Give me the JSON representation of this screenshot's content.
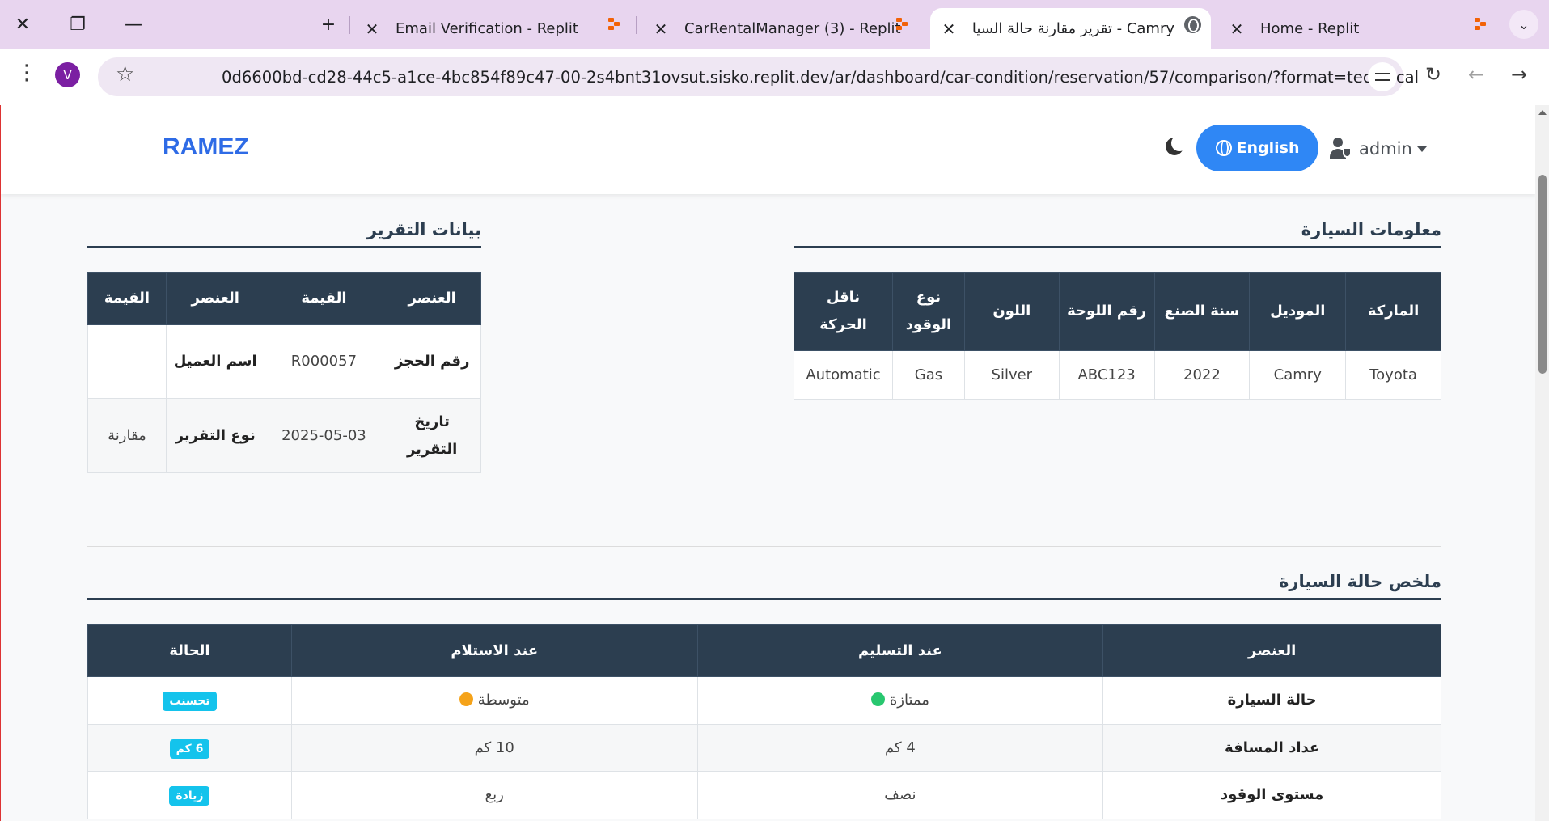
{
  "browser": {
    "tabs": [
      {
        "title": "Email Verification - Replit"
      },
      {
        "title": "CarRentalManager (3) - Replit"
      },
      {
        "title": "Camry - تقرير مقارنة حالة السيارة"
      },
      {
        "title": "Home - Replit"
      }
    ],
    "profile_initial": "V",
    "url": "0d6600bd-cd28-44c5-a1ce-4bc854f89c47-00-2s4bnt31ovsut.sisko.replit.dev/ar/dashboard/car-condition/reservation/57/comparison/?format=technical"
  },
  "navbar": {
    "brand": "RAMEZ",
    "language_button": "English",
    "user_name": "admin"
  },
  "report_data": {
    "title": "بيانات التقرير",
    "headers": [
      "العنصر",
      "القيمة",
      "العنصر",
      "القيمة"
    ],
    "rows": [
      [
        "رقم الحجز",
        "R000057",
        "اسم العميل",
        ""
      ],
      [
        "تاريخ التقرير",
        "2025-05-03",
        "نوع التقرير",
        "مقارنة"
      ]
    ]
  },
  "car_info": {
    "title": "معلومات السيارة",
    "headers": [
      "الماركة",
      "الموديل",
      "سنة الصنع",
      "رقم اللوحة",
      "اللون",
      "نوع الوقود",
      "ناقل الحركة"
    ],
    "values": [
      "Toyota",
      "Camry",
      "2022",
      "ABC123",
      "Silver",
      "Gas",
      "Automatic"
    ]
  },
  "summary": {
    "title": "ملخص حالة السيارة",
    "headers": [
      "العنصر",
      "عند التسليم",
      "عند الاستلام",
      "الحالة"
    ],
    "rows": [
      {
        "item": "حالة السيارة",
        "delivery": "ممتازة",
        "receipt": "متوسطة",
        "status": "تحسنت"
      },
      {
        "item": "عداد المسافة",
        "delivery": "4 كم",
        "receipt": "10 كم",
        "status": "6 كم"
      },
      {
        "item": "مستوى الوقود",
        "delivery": "نصف",
        "receipt": "ربع",
        "status": "زيادة"
      }
    ]
  },
  "colors": {
    "header_bg": "#2c3e50",
    "brand": "#2e6be6",
    "lang_button": "#2f87f5",
    "badge": "#14c3ec",
    "excellent_dot": "#28c76f",
    "average_dot": "#f5a31a"
  }
}
